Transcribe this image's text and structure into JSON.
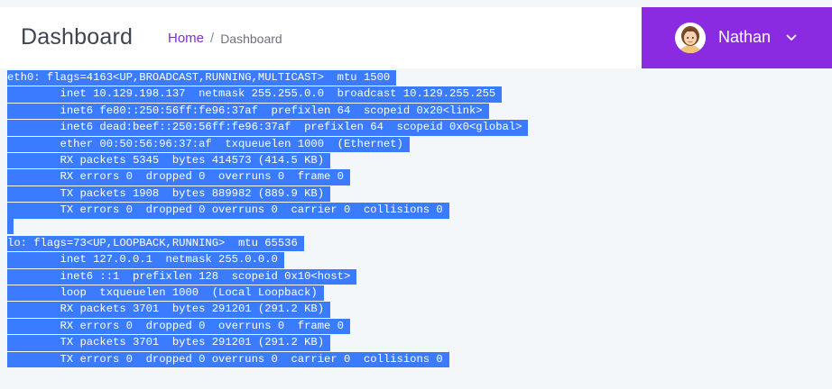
{
  "header": {
    "page_title": "Dashboard",
    "breadcrumb": {
      "home": "Home",
      "separator": "/",
      "current": "Dashboard"
    }
  },
  "user_menu": {
    "name": "Nathan",
    "avatar_icon": "user-avatar",
    "chevron_icon": "chevron-down-icon",
    "accent_color": "#8a2be2"
  },
  "terminal": {
    "selection_color": "#3b7bff",
    "lines": [
      "eth0: flags=4163<UP,BROADCAST,RUNNING,MULTICAST>  mtu 1500",
      "        inet 10.129.198.137  netmask 255.255.0.0  broadcast 10.129.255.255",
      "        inet6 fe80::250:56ff:fe96:37af  prefixlen 64  scopeid 0x20<link>",
      "        inet6 dead:beef::250:56ff:fe96:37af  prefixlen 64  scopeid 0x0<global>",
      "        ether 00:50:56:96:37:af  txqueuelen 1000  (Ethernet)",
      "        RX packets 5345  bytes 414573 (414.5 KB)",
      "        RX errors 0  dropped 0  overruns 0  frame 0",
      "        TX packets 1908  bytes 889982 (889.9 KB)",
      "        TX errors 0  dropped 0 overruns 0  carrier 0  collisions 0",
      "",
      "lo: flags=73<UP,LOOPBACK,RUNNING>  mtu 65536",
      "        inet 127.0.0.1  netmask 255.0.0.0",
      "        inet6 ::1  prefixlen 128  scopeid 0x10<host>",
      "        loop  txqueuelen 1000  (Local Loopback)",
      "        RX packets 3701  bytes 291201 (291.2 KB)",
      "        RX errors 0  dropped 0  overruns 0  frame 0",
      "        TX packets 3701  bytes 291201 (291.2 KB)",
      "        TX errors 0  dropped 0 overruns 0  carrier 0  collisions 0"
    ]
  }
}
